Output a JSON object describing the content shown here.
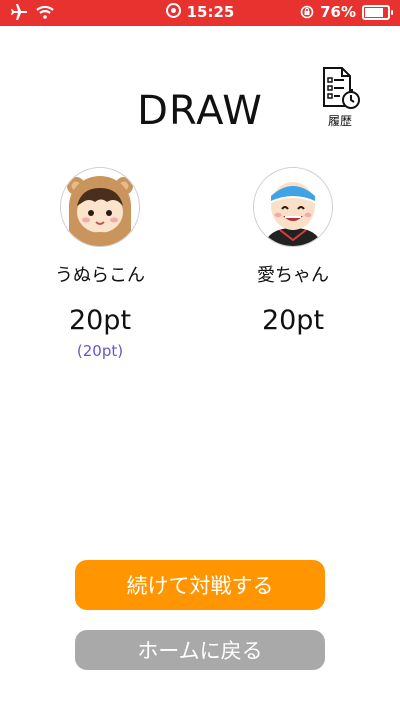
{
  "status_bar": {
    "time": "15:25",
    "battery_text": "76%",
    "battery_level": 0.76,
    "background_color": "#e8322f",
    "icons": [
      "airplane-icon",
      "wifi-icon",
      "screen-record-icon",
      "rotation-lock-icon",
      "battery-icon"
    ]
  },
  "result": {
    "title": "DRAW"
  },
  "history": {
    "label": "履歴",
    "icon": "history-document-clock-icon"
  },
  "players": [
    {
      "name": "うぬらこん",
      "score": "20pt",
      "previous": "(20pt)",
      "avatar": "bear-hood-girl-avatar"
    },
    {
      "name": "愛ちゃん",
      "score": "20pt",
      "avatar": "smiling-boy-headband-avatar"
    }
  ],
  "buttons": {
    "continue": "続けて対戦する",
    "home": "ホームに戻る",
    "continue_color": "#ff9500",
    "home_color": "#a9a9a9"
  }
}
